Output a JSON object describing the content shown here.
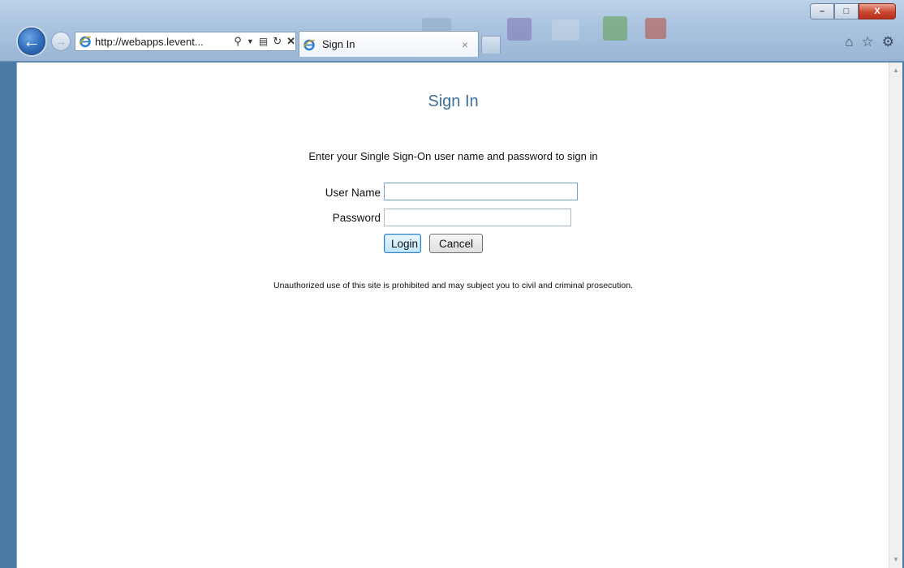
{
  "browser": {
    "address": "http://webapps.levent...",
    "tab_title": "Sign In",
    "tab_close": "×",
    "window_buttons": {
      "minimize": "–",
      "maximize": "□",
      "close": "X"
    },
    "icons": [
      "back-arrow-icon",
      "forward-arrow-icon",
      "ie-logo-icon",
      "search-icon",
      "compatibility-icon",
      "refresh-icon",
      "stop-icon",
      "home-icon",
      "favorites-star-icon",
      "settings-gear-icon"
    ]
  },
  "page": {
    "title": "Sign In",
    "instructions": "Enter your Single Sign-On user name and password to sign in",
    "form": {
      "username_label": "User Name",
      "username_value": "",
      "password_label": "Password",
      "password_value": "",
      "login_label": "Login",
      "cancel_label": "Cancel"
    },
    "disclaimer": "Unauthorized use of this site is prohibited and may subject you to civil and criminal prosecution."
  },
  "colors": {
    "title": "#3d6f9c",
    "chrome": "#a9c3df",
    "default_button_border": "#3c7fb1"
  }
}
